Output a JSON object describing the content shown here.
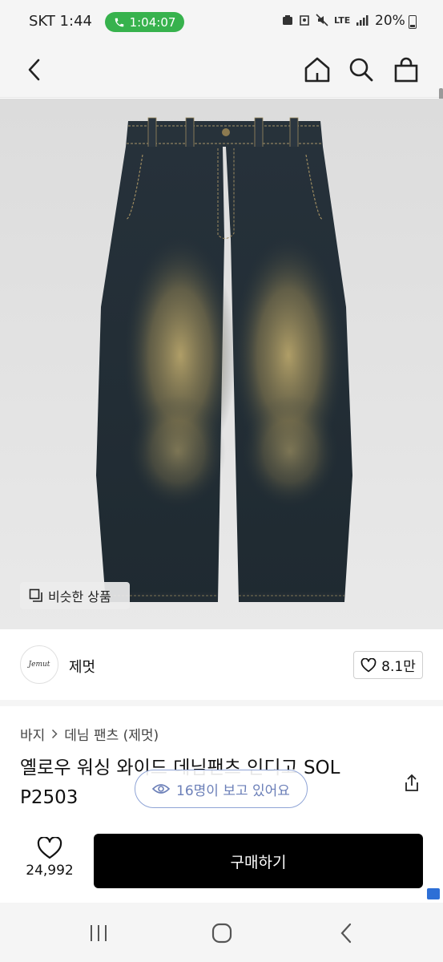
{
  "status_bar": {
    "carrier_time": "SKT 1:44",
    "call_timer": "1:04:07",
    "network": "LTE",
    "battery": "20%"
  },
  "header": {
    "back_icon": "chevron-left-icon",
    "home_icon": "home-icon",
    "search_icon": "search-icon",
    "bag_icon": "shopping-bag-icon"
  },
  "image": {
    "similar_label": "비슷한 상품"
  },
  "brand": {
    "logo_text": "Jemut",
    "name": "제멋",
    "like_count": "8.1만"
  },
  "product": {
    "category": [
      "바지",
      "데님 팬츠 (제멋)"
    ],
    "title": "옐로우 워싱 와이드 데님팬츠 인디고 SOL P2503",
    "viewers": "16명이 보고 있어요"
  },
  "action_bar": {
    "wish_count": "24,992",
    "buy_label": "구매하기"
  },
  "colors": {
    "call_pill": "#37b24d",
    "buy_button": "#000000",
    "viewer_accent": "#6b7fb8"
  }
}
